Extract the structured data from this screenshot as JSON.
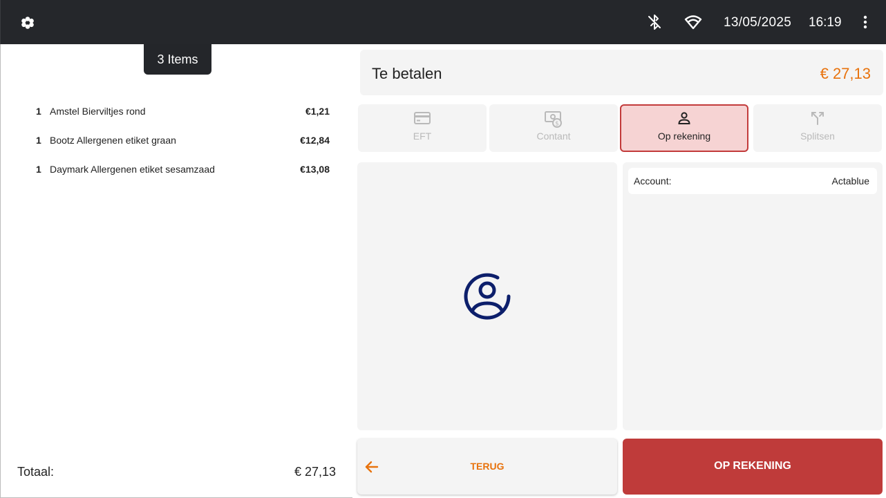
{
  "status_bar": {
    "logo_icon": "flower-logo-icon",
    "bluetooth_icon": "bluetooth-off-icon",
    "wifi_icon": "wifi-icon",
    "date": "13/05/2025",
    "time": "16:19",
    "menu_icon": "more-vertical-icon"
  },
  "cart": {
    "items_badge": "3 Items",
    "lines": [
      {
        "qty": "1",
        "name": "Amstel Bierviltjes rond",
        "price": "€1,21"
      },
      {
        "qty": "1",
        "name": "Bootz Allergenen etiket graan",
        "price": "€12,84"
      },
      {
        "qty": "1",
        "name": "Daymark Allergenen etiket sesamzaad",
        "price": "€13,08"
      }
    ],
    "total_label": "Totaal:",
    "total_value": "€ 27,13"
  },
  "payment": {
    "due_label": "Te betalen",
    "due_amount": "€ 27,13",
    "methods": [
      {
        "label": "EFT",
        "icon": "credit-card-icon",
        "active": false
      },
      {
        "label": "Contant",
        "icon": "cash-icon",
        "active": false
      },
      {
        "label": "Op rekening",
        "icon": "person-icon",
        "active": true
      },
      {
        "label": "Splitsen",
        "icon": "split-icon",
        "active": false
      }
    ],
    "account_label": "Account:",
    "account_value": "Actablue",
    "back_label": "Terug",
    "confirm_label": "Op rekening"
  },
  "colors": {
    "topbar": "#25272b",
    "accent_orange": "#e8720c",
    "accent_red": "#bf3b3a",
    "active_bg": "#f6d3d3",
    "avatar_blue": "#0d1f6b"
  }
}
